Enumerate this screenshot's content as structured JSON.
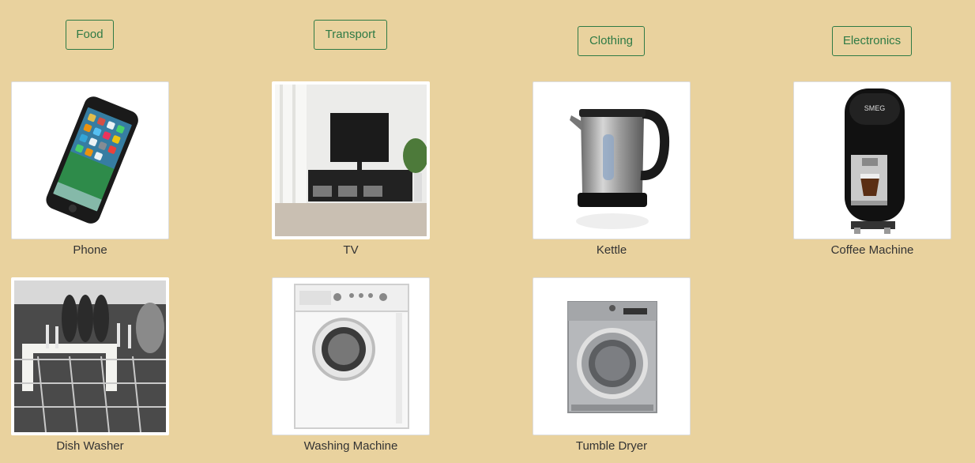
{
  "categories": [
    {
      "label": "Food"
    },
    {
      "label": "Transport"
    },
    {
      "label": "Clothing"
    },
    {
      "label": "Electronics"
    }
  ],
  "items": [
    {
      "name": "Phone",
      "icon": "phone-image"
    },
    {
      "name": "TV",
      "icon": "tv-image"
    },
    {
      "name": "Kettle",
      "icon": "kettle-image"
    },
    {
      "name": "Coffee Machine",
      "icon": "coffee-machine-image"
    },
    {
      "name": "Dish Washer",
      "icon": "dish-washer-image"
    },
    {
      "name": "Washing Machine",
      "icon": "washing-machine-image"
    },
    {
      "name": "Tumble Dryer",
      "icon": "tumble-dryer-image"
    }
  ],
  "colors": {
    "background": "#e9d29e",
    "accent": "#2f7a45"
  }
}
